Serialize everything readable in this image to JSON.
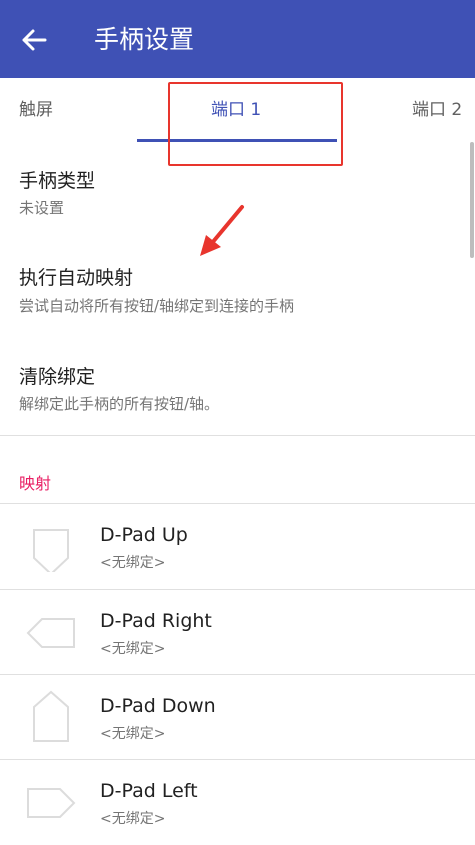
{
  "app_bar": {
    "title": "手柄设置",
    "color": "#3f51b5"
  },
  "tabs": [
    {
      "label": "触屏",
      "selected": false
    },
    {
      "label": "端口 1",
      "selected": true
    },
    {
      "label": "端口 2",
      "selected": false
    }
  ],
  "settings": {
    "controller_type": {
      "title": "手柄类型",
      "summary": "未设置"
    },
    "auto_map": {
      "title": "执行自动映射",
      "summary": "尝试自动将所有按钮/轴绑定到连接的手柄"
    },
    "clear_binds": {
      "title": "清除绑定",
      "summary": "解绑定此手柄的所有按钮/轴。"
    }
  },
  "mapping_section": {
    "header": "映射",
    "color": "#e91e63"
  },
  "mappings": [
    {
      "name": "D-Pad Up",
      "binding": "<无绑定>",
      "icon": "dpad-up-icon"
    },
    {
      "name": "D-Pad Right",
      "binding": "<无绑定>",
      "icon": "dpad-right-icon"
    },
    {
      "name": "D-Pad Down",
      "binding": "<无绑定>",
      "icon": "dpad-down-icon"
    },
    {
      "name": "D-Pad Left",
      "binding": "<无绑定>",
      "icon": "dpad-left-icon"
    }
  ],
  "annotation_color": "#e8352d"
}
